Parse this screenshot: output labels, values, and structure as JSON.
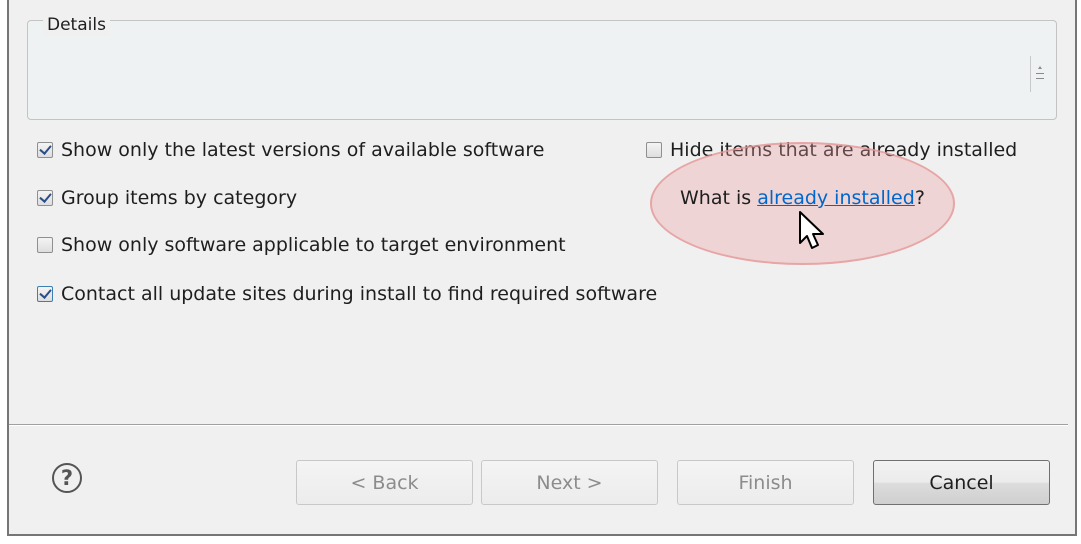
{
  "details": {
    "label": "Details"
  },
  "options": [
    {
      "label": "Show only the latest versions of available software",
      "checked": true
    },
    {
      "label": "Group items by category",
      "checked": true
    },
    {
      "label": "Show only software applicable to target environment",
      "checked": false
    },
    {
      "label": "Contact all update sites during install to find required software",
      "checked": true
    }
  ],
  "hide_installed": {
    "label": "Hide items that are already installed",
    "checked": false
  },
  "what_is": {
    "prefix": "What is ",
    "link": "already installed",
    "suffix": "?"
  },
  "buttons": {
    "back": "< Back",
    "next": "Next >",
    "finish": "Finish",
    "cancel": "Cancel"
  },
  "icons": {
    "help": "?"
  },
  "colors": {
    "link": "#0066cc",
    "highlight": "#eb9b9b"
  }
}
